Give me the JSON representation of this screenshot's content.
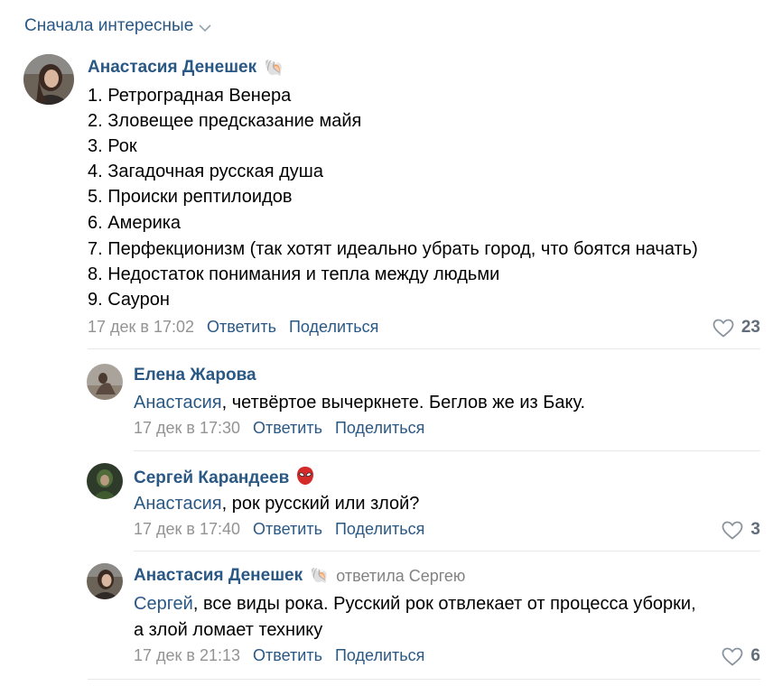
{
  "sort": {
    "label": "Сначала интересные"
  },
  "comments": [
    {
      "author": "Анастасия Денешек",
      "lines": [
        "1. Ретроградная Венера",
        "2. Зловещее предсказание майя",
        "3. Рок",
        "4. Загадочная русская душа",
        "5. Происки рептилоидов",
        "6. Америка",
        "7. Перфекционизм (так хотят идеально убрать город, что боятся начать)",
        "8. Недостаток понимания и тепла между людьми",
        "9. Саурон"
      ],
      "date": "17 дек в 17:02",
      "reply": "Ответить",
      "share": "Поделиться",
      "likes": "23"
    }
  ],
  "replies": [
    {
      "author": "Елена Жарова",
      "mention": "Анастасия",
      "text": ", четвёртое вычеркнете. Беглов же из Баку.",
      "date": "17 дек в 17:30",
      "reply": "Ответить",
      "share": "Поделиться"
    },
    {
      "author": "Сергей Карандеев",
      "mention": "Анастасия",
      "text": ", рок русский или злой?",
      "date": "17 дек в 17:40",
      "reply": "Ответить",
      "share": "Поделиться",
      "likes": "3"
    },
    {
      "author": "Анастасия Денешек",
      "reply_note": "ответила Сергею",
      "mention": "Сергей",
      "text": ", все виды рока. Русский рок отвлекает от процесса уборки,",
      "text2": "а злой ломает технику",
      "date": "17 дек в 21:13",
      "reply": "Ответить",
      "share": "Поделиться",
      "likes": "6"
    }
  ],
  "colors": {
    "link": "#2a5885",
    "meta": "#939393",
    "divider": "#e7e8ec",
    "like": "#626d7a"
  }
}
